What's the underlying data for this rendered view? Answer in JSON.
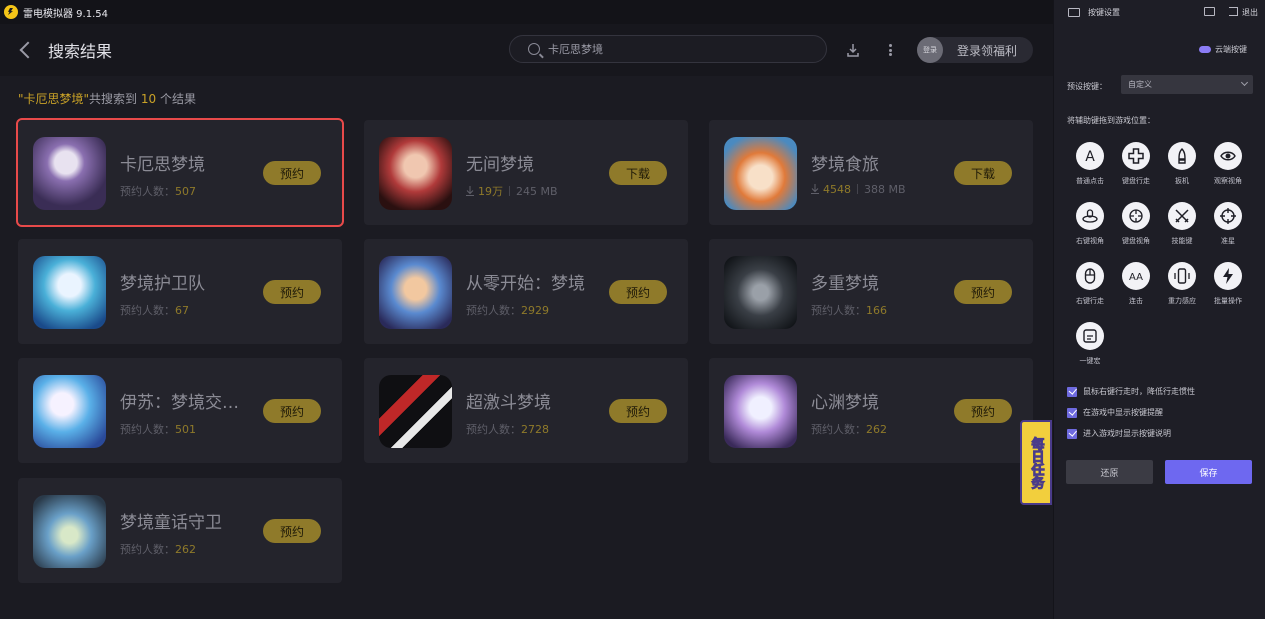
{
  "app": {
    "title": "雷电模拟器 9.1.54"
  },
  "header": {
    "title": "搜索结果",
    "search_value": "卡厄思梦境",
    "login_avatar_text": "登录",
    "login_text": "登录领福利"
  },
  "summary": {
    "query": "\"卡厄思梦境\"",
    "prefix": "共搜索到 ",
    "count": "10",
    "suffix": " 个结果"
  },
  "results": [
    {
      "name": "卡厄思梦境",
      "meta_label": "预约人数：",
      "meta_value": "507",
      "button": "预约",
      "type": "reserve",
      "selected": true
    },
    {
      "name": "无间梦境",
      "downloads": "19万",
      "size": "245 MB",
      "button": "下载",
      "type": "download"
    },
    {
      "name": "梦境食旅",
      "downloads": "4548",
      "size": "388 MB",
      "button": "下载",
      "type": "download"
    },
    {
      "name": "梦境护卫队",
      "meta_label": "预约人数：",
      "meta_value": "67",
      "button": "预约",
      "type": "reserve"
    },
    {
      "name": "从零开始：梦境",
      "meta_label": "预约人数：",
      "meta_value": "2929",
      "button": "预约",
      "type": "reserve"
    },
    {
      "name": "多重梦境",
      "meta_label": "预约人数：",
      "meta_value": "166",
      "button": "预约",
      "type": "reserve"
    },
    {
      "name": "伊苏：梦境交…",
      "meta_label": "预约人数：",
      "meta_value": "501",
      "button": "预约",
      "type": "reserve"
    },
    {
      "name": "超激斗梦境",
      "meta_label": "预约人数：",
      "meta_value": "2728",
      "button": "预约",
      "type": "reserve"
    },
    {
      "name": "心渊梦境",
      "meta_label": "预约人数：",
      "meta_value": "262",
      "button": "预约",
      "type": "reserve"
    },
    {
      "name": "梦境童话守卫",
      "meta_label": "预约人数：",
      "meta_value": "262",
      "button": "预约",
      "type": "reserve"
    }
  ],
  "panel": {
    "title": "按键设置",
    "exit": "退出",
    "cloud": "云端按键",
    "preset_label": "预设按键：",
    "preset_value": "自定义",
    "drag_hint": "将辅助键拖到游戏位置：",
    "keys": [
      {
        "label": "普通点击",
        "icon": "letter-a-icon"
      },
      {
        "label": "键盘行走",
        "icon": "dpad-icon"
      },
      {
        "label": "扳机",
        "icon": "bullet-icon"
      },
      {
        "label": "观察视角",
        "icon": "eye-icon"
      },
      {
        "label": "右键视角",
        "icon": "mouse-view-icon"
      },
      {
        "label": "键盘视角",
        "icon": "keyboard-view-icon"
      },
      {
        "label": "技能键",
        "icon": "swords-icon"
      },
      {
        "label": "准星",
        "icon": "crosshair-icon"
      },
      {
        "label": "右键行走",
        "icon": "mouse-icon"
      },
      {
        "label": "连击",
        "icon": "double-a-icon"
      },
      {
        "label": "重力感应",
        "icon": "phone-tilt-icon"
      },
      {
        "label": "批量操作",
        "icon": "lightning-icon"
      },
      {
        "label": "一键宏",
        "icon": "macro-icon"
      }
    ],
    "options": [
      "鼠标右键行走时，降低行走惯性",
      "在游戏中显示按键提醒",
      "进入游戏时显示按键说明"
    ],
    "restore": "还原",
    "save": "保存"
  },
  "daily_task": "每日任务",
  "colors": {
    "accent_gold": "#8f7a2a",
    "primary_purple": "#6e68f0",
    "selection_red": "#e84a4a"
  }
}
